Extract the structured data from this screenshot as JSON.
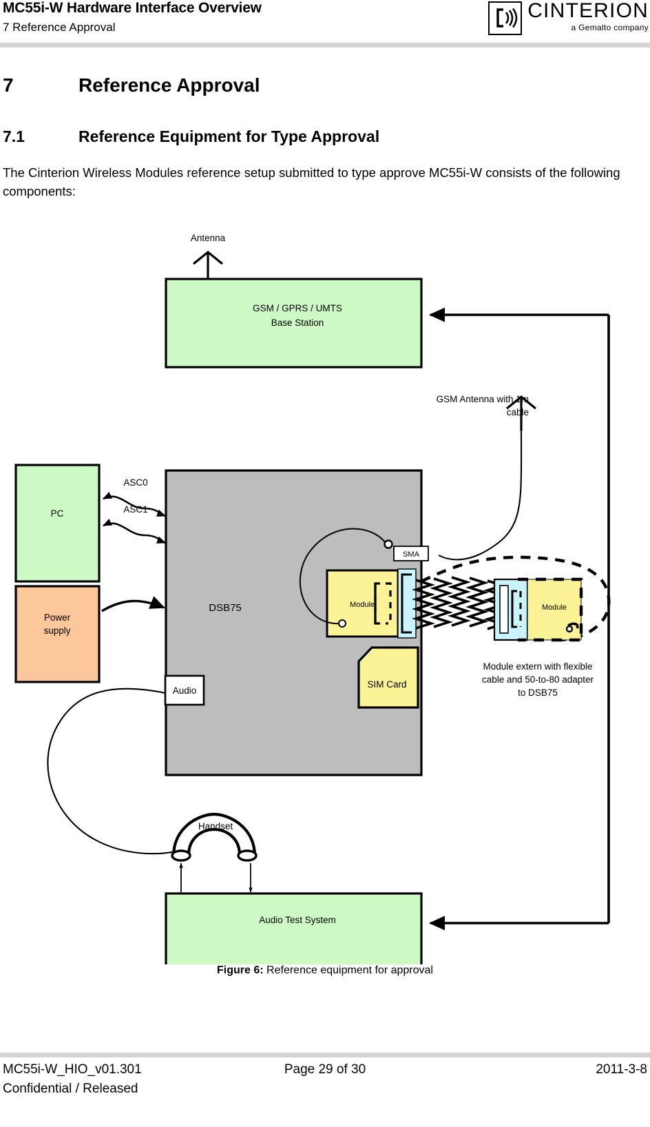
{
  "header": {
    "title": "MC55i-W Hardware Interface Overview",
    "subtitle": "7 Reference Approval",
    "brand_name": "CINTERION",
    "brand_tagline": "a Gemalto company"
  },
  "content": {
    "section_number": "7",
    "section_title": "Reference Approval",
    "subsection_number": "7.1",
    "subsection_title": "Reference Equipment for Type Approval",
    "paragraph": "The Cinterion Wireless Modules reference setup submitted to type approve MC55i-W consists of the following components:"
  },
  "figure": {
    "caption_label": "Figure 6:",
    "caption_text": "Reference equipment for approval",
    "blocks": {
      "antenna_label": "Antenna",
      "base_station_line1": "GSM / GPRS / UMTS",
      "base_station_line2": "Base Station",
      "gsm_antenna_line1": "GSM Antenna with  1m",
      "gsm_antenna_line2": "cable",
      "pc": "PC",
      "asc0": "ASC0",
      "asc1": "ASC1",
      "power_supply_line1": "Power",
      "power_supply_line2": "supply",
      "dsb75": "DSB75",
      "audio": "Audio",
      "module": "Module",
      "sma": "SMA",
      "sim_card": "SIM Card",
      "module_extern": "Module",
      "extern_note_line1": "Module extern with flexible",
      "extern_note_line2": "cable and 50-to-80 adapter",
      "extern_note_line3": "to DSB75",
      "handset": "Handset",
      "audio_test_system": "Audio Test System"
    },
    "colors": {
      "green_fill": "#ccf9c4",
      "orange_fill": "#fcc79a",
      "yellow_fill": "#fbf396",
      "cyan_fill": "#c9f4fb",
      "gray_fill": "#bdbdbd",
      "white_fill": "#ffffff",
      "stroke": "#000000"
    }
  },
  "footer": {
    "doc_id": "MC55i-W_HIO_v01.301",
    "classification": "Confidential / Released",
    "page": "Page 29 of 30",
    "date": "2011-3-8"
  }
}
